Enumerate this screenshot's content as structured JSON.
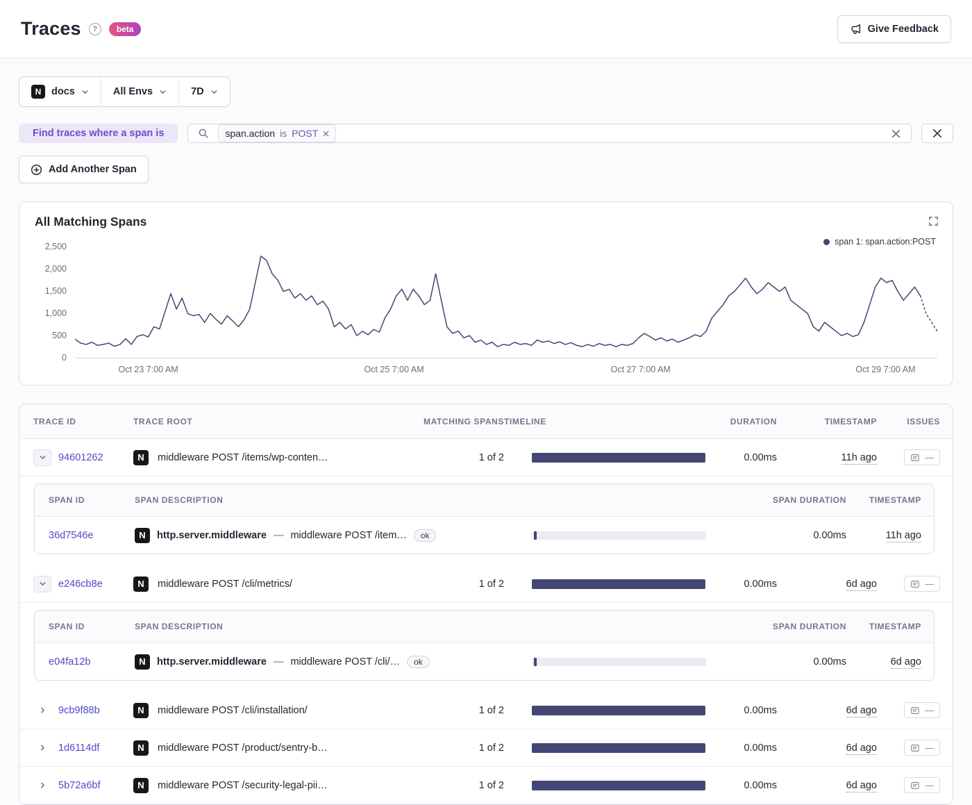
{
  "page": {
    "title": "Traces",
    "beta_badge": "beta",
    "feedback_button": "Give Feedback"
  },
  "icons": {
    "help": "?",
    "project_letter": "N"
  },
  "colors": {
    "link": "#4f4ac9",
    "bar": "#444674",
    "accent_text": "#6a50c8",
    "accent_bg": "#ece6f9",
    "badge_from": "#e4567f",
    "badge_to": "#a944c0"
  },
  "filters": {
    "project": "docs",
    "env": "All Envs",
    "period": "7D"
  },
  "search": {
    "where_label": "Find traces where a span is",
    "token": {
      "key": "span.action",
      "op": "is",
      "value": "POST"
    },
    "add_span_button": "Add Another Span"
  },
  "chart": {
    "title": "All Matching Spans",
    "legend": "span 1: span.action:POST",
    "legend_color": "#444674",
    "line_color": "#444674",
    "y_max": 2500,
    "y_ticks": [
      "2,500",
      "2,000",
      "1,500",
      "1,000",
      "500",
      "0"
    ],
    "x_labels": [
      {
        "text": "Oct 23 7:00 AM",
        "pos": 8.5
      },
      {
        "text": "Oct 25 7:00 AM",
        "pos": 37
      },
      {
        "text": "Oct 27 7:00 AM",
        "pos": 65.6
      },
      {
        "text": "Oct 29 7:00 AM",
        "pos": 94
      }
    ],
    "dotted_tail": 3,
    "values": [
      420,
      330,
      300,
      350,
      280,
      300,
      330,
      260,
      300,
      430,
      300,
      480,
      520,
      470,
      700,
      650,
      1050,
      1450,
      1100,
      1350,
      1000,
      950,
      980,
      800,
      1000,
      870,
      760,
      950,
      830,
      700,
      860,
      1100,
      1700,
      2300,
      2200,
      1900,
      1750,
      1500,
      1550,
      1350,
      1450,
      1300,
      1400,
      1200,
      1280,
      1100,
      700,
      800,
      650,
      750,
      500,
      600,
      520,
      640,
      580,
      900,
      1100,
      1400,
      1550,
      1300,
      1550,
      1400,
      1200,
      1300,
      1900,
      1300,
      700,
      550,
      600,
      450,
      500,
      350,
      400,
      300,
      350,
      250,
      300,
      280,
      350,
      300,
      320,
      280,
      400,
      350,
      380,
      320,
      360,
      300,
      340,
      280,
      250,
      300,
      260,
      320,
      280,
      300,
      250,
      300,
      280,
      320,
      450,
      550,
      480,
      400,
      450,
      380,
      420,
      350,
      400,
      450,
      520,
      480,
      600,
      900,
      1050,
      1200,
      1400,
      1500,
      1650,
      1800,
      1600,
      1450,
      1550,
      1700,
      1600,
      1500,
      1600,
      1300,
      1200,
      1100,
      1000,
      700,
      600,
      800,
      700,
      600,
      500,
      550,
      480,
      520,
      800,
      1200,
      1600,
      1800,
      1700,
      1750,
      1500,
      1300,
      1450,
      1600,
      1400,
      1000,
      800,
      600
    ]
  },
  "table": {
    "columns": [
      "Trace ID",
      "Trace Root",
      "Matching Spans",
      "Timeline",
      "Duration",
      "Timestamp",
      "Issues"
    ],
    "span_columns": [
      "Span ID",
      "Span Description",
      "Span Duration",
      "Timestamp"
    ],
    "issues_placeholder": "—",
    "bar_color": "#444674",
    "span_separator": "—",
    "rows": [
      {
        "id": "94601262",
        "expanded": true,
        "root": "middleware POST /items/wp-conten…",
        "matching": "1 of 2",
        "duration": "0.00ms",
        "timestamp": "11h ago",
        "spans": [
          {
            "id": "36d7546e",
            "op": "http.server.middleware",
            "desc": "middleware POST /item…",
            "status": "ok",
            "duration": "0.00ms",
            "timestamp": "11h ago"
          }
        ]
      },
      {
        "id": "e246cb8e",
        "expanded": true,
        "root": "middleware POST /cli/metrics/",
        "matching": "1 of 2",
        "duration": "0.00ms",
        "timestamp": "6d ago",
        "spans": [
          {
            "id": "e04fa12b",
            "op": "http.server.middleware",
            "desc": "middleware POST /cli/…",
            "status": "ok",
            "duration": "0.00ms",
            "timestamp": "6d ago"
          }
        ]
      },
      {
        "id": "9cb9f88b",
        "expanded": false,
        "root": "middleware POST /cli/installation/",
        "matching": "1 of 2",
        "duration": "0.00ms",
        "timestamp": "6d ago",
        "spans": []
      },
      {
        "id": "1d6114df",
        "expanded": false,
        "root": "middleware POST /product/sentry-b…",
        "matching": "1 of 2",
        "duration": "0.00ms",
        "timestamp": "6d ago",
        "spans": []
      },
      {
        "id": "5b72a6bf",
        "expanded": false,
        "root": "middleware POST /security-legal-pii…",
        "matching": "1 of 2",
        "duration": "0.00ms",
        "timestamp": "6d ago",
        "spans": []
      }
    ]
  }
}
